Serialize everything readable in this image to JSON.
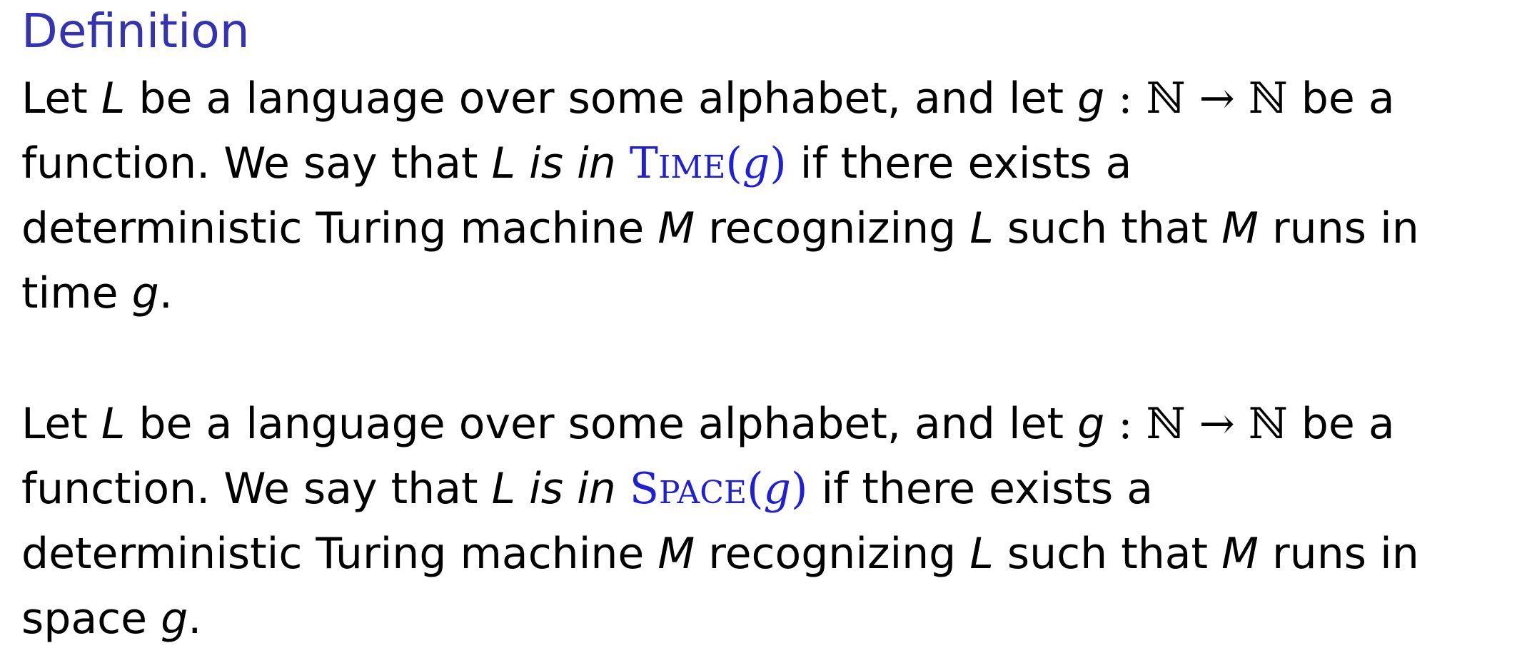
{
  "definition": {
    "title": "Definition",
    "time_paragraph": {
      "line1": {
        "a": "Let ",
        "L": "L",
        "b": " be a language over some alphabet, and let ",
        "g": "g",
        "c": " : ",
        "N1": "ℕ",
        "arrow": " → ",
        "N2": "ℕ",
        "d": " be a"
      },
      "line2": {
        "a": "function. We say that ",
        "L": "L",
        "isin": " is in ",
        "class_first": "T",
        "class_rest": "IME",
        "open": "(",
        "g": "g",
        "close": ")",
        "b": " if there exists a"
      },
      "line3": {
        "a": "deterministic Turing machine ",
        "M": "M",
        "b": " recognizing ",
        "L": "L",
        "c": " such that ",
        "M2": "M",
        "d": " runs in"
      },
      "line4": {
        "a": "time ",
        "g": "g",
        "b": "."
      }
    },
    "space_paragraph": {
      "line1": {
        "a": "Let ",
        "L": "L",
        "b": " be a language over some alphabet, and let ",
        "g": "g",
        "c": " : ",
        "N1": "ℕ",
        "arrow": " → ",
        "N2": "ℕ",
        "d": " be a"
      },
      "line2": {
        "a": "function. We say that ",
        "L": "L",
        "isin": " is in ",
        "class_first": "S",
        "class_rest": "PACE",
        "open": "(",
        "g": "g",
        "close": ")",
        "b": " if there exists a"
      },
      "line3": {
        "a": "deterministic Turing machine ",
        "M": "M",
        "b": " recognizing ",
        "L": "L",
        "c": " such that ",
        "M2": "M",
        "d": " runs in"
      },
      "line4": {
        "a": "space ",
        "g": "g",
        "b": "."
      }
    }
  },
  "colors": {
    "title": "#3333b3",
    "class_name": "#1f1fd6",
    "text": "#000000"
  }
}
